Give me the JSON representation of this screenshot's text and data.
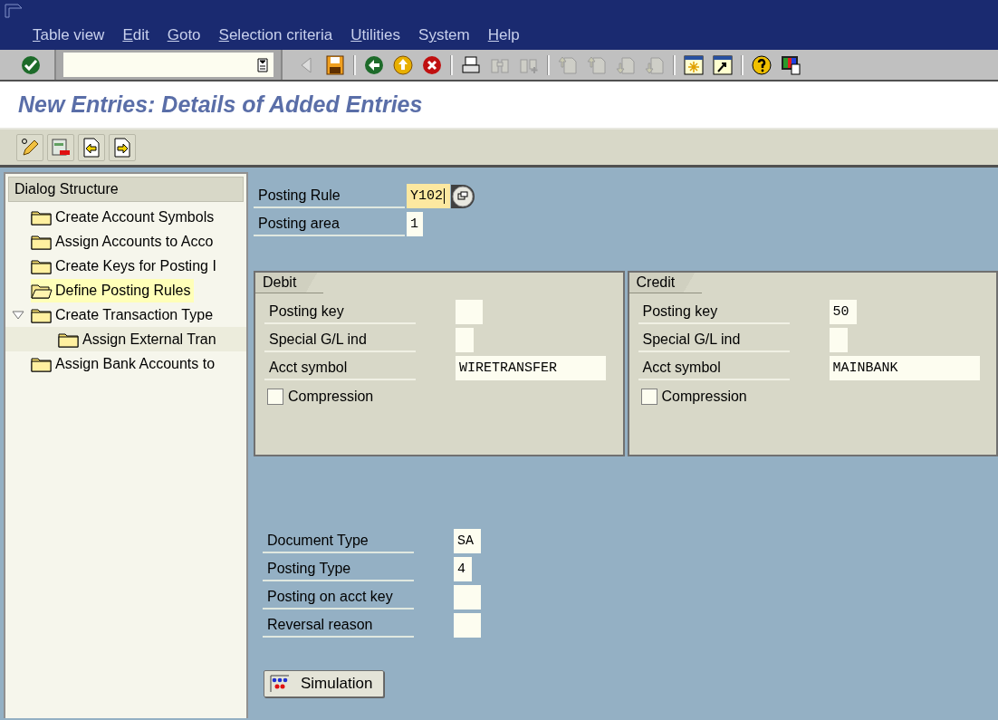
{
  "menu": [
    {
      "key": "T",
      "rest": "able view"
    },
    {
      "key": "E",
      "rest": "dit"
    },
    {
      "key": "G",
      "rest": "oto"
    },
    {
      "key": "S",
      "rest": "election criteria"
    },
    {
      "key": "U",
      "rest": "tilities"
    },
    {
      "pre": "S",
      "key": "y",
      "rest": "stem"
    },
    {
      "key": "H",
      "rest": "elp"
    }
  ],
  "toolbar": [
    {
      "kind": "enter",
      "disabled": false
    },
    {
      "kind": "command"
    },
    {
      "kind": "back-arrow",
      "disabled": true
    },
    {
      "kind": "save",
      "disabled": false
    },
    {
      "kind": "sep"
    },
    {
      "kind": "back",
      "disabled": false
    },
    {
      "kind": "exit",
      "disabled": false
    },
    {
      "kind": "cancel",
      "disabled": false
    },
    {
      "kind": "sep"
    },
    {
      "kind": "print",
      "disabled": false
    },
    {
      "kind": "find",
      "disabled": true
    },
    {
      "kind": "find-next",
      "disabled": true
    },
    {
      "kind": "sep"
    },
    {
      "kind": "first",
      "disabled": true
    },
    {
      "kind": "prev",
      "disabled": true
    },
    {
      "kind": "next",
      "disabled": true
    },
    {
      "kind": "last",
      "disabled": true
    },
    {
      "kind": "sep"
    },
    {
      "kind": "session",
      "disabled": false
    },
    {
      "kind": "shortcut",
      "disabled": false
    },
    {
      "kind": "sep"
    },
    {
      "kind": "help",
      "disabled": false
    },
    {
      "kind": "layout",
      "disabled": false
    }
  ],
  "title": "New Entries: Details of Added Entries",
  "app_toolbar": [
    {
      "kind": "edit"
    },
    {
      "kind": "delete"
    },
    {
      "kind": "previous"
    },
    {
      "kind": "next-entry"
    }
  ],
  "dialog_structure": {
    "title": "Dialog Structure",
    "items": [
      {
        "label": "Create Account Symbols",
        "selected": false
      },
      {
        "label": "Assign Accounts to Acco",
        "selected": false
      },
      {
        "label": "Create Keys for Posting I",
        "selected": false
      },
      {
        "label": "Define Posting Rules",
        "selected": true
      },
      {
        "label": "Create Transaction Type",
        "selected": false,
        "expanded": true,
        "children": [
          {
            "label": "Assign External Tran",
            "selected": false
          }
        ]
      },
      {
        "label": "Assign Bank Accounts to",
        "selected": false
      }
    ]
  },
  "header_fields": [
    {
      "label": "Posting Rule",
      "value": "Y102",
      "focused": true
    },
    {
      "label": "Posting area",
      "value": "1",
      "focused": false
    }
  ],
  "panels": [
    {
      "title": "Debit",
      "fields": [
        {
          "label": "Posting key"
        },
        {
          "label": "Special G/L ind"
        },
        {
          "label": "Acct symbol",
          "value": "WIRETRANSFER"
        }
      ],
      "compression": {
        "label": "Compression",
        "checked": false
      }
    },
    {
      "title": "Credit",
      "fields": [
        {
          "label": "Posting key",
          "value": "50"
        },
        {
          "label": "Special G/L ind"
        },
        {
          "label": "Acct symbol",
          "value": "MAINBANK"
        }
      ],
      "compression": {
        "label": "Compression",
        "checked": false
      }
    }
  ],
  "document_fields": [
    {
      "label": "Document Type",
      "value": "SA"
    },
    {
      "label": "Posting Type",
      "value": "4"
    },
    {
      "label": "Posting on acct key"
    },
    {
      "label": "Reversal reason"
    }
  ],
  "simulation_button": {
    "label": "Simulation"
  }
}
